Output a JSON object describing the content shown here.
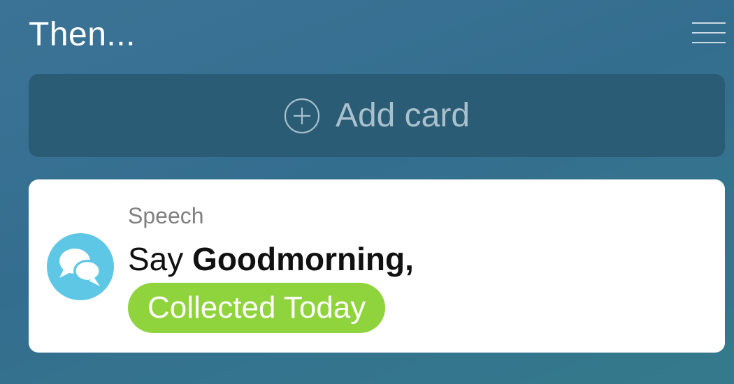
{
  "header": {
    "title": "Then...",
    "menu_icon": "hamburger-menu-icon"
  },
  "add_card": {
    "label": "Add card",
    "icon": "plus-circle-icon"
  },
  "speech_card": {
    "type_label": "Speech",
    "icon": "speech-bubbles-icon",
    "say_word": "Say",
    "say_text": "Goodmorning,",
    "tag": "Collected Today",
    "colors": {
      "avatar": "#5ec7e5",
      "tag": "#8fd33d"
    }
  }
}
